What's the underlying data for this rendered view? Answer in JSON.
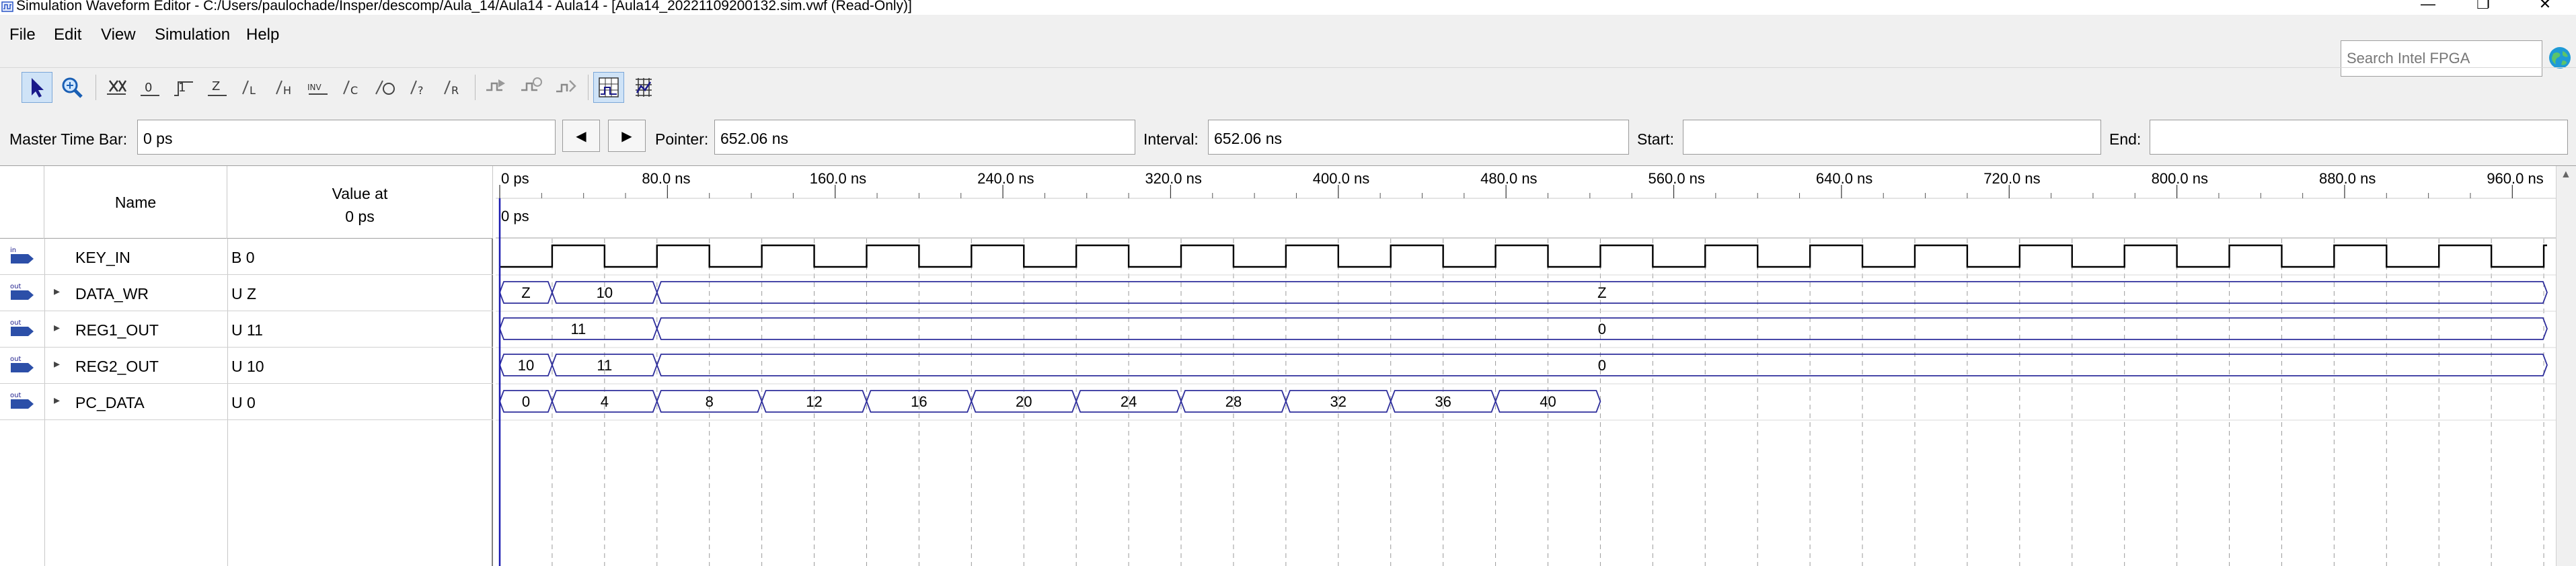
{
  "window": {
    "title": "Simulation Waveform Editor - C:/Users/paulochade/Insper/descomp/Aula_14/Aula14 - Aula14 - [Aula14_20221109200132.sim.vwf (Read-Only)]",
    "minimize": "—",
    "maximize": "❐",
    "close": "✕"
  },
  "menu": {
    "file": "File",
    "edit": "Edit",
    "view": "View",
    "simulation": "Simulation",
    "help": "Help"
  },
  "search": {
    "placeholder": "Search Intel FPGA"
  },
  "timebar": {
    "master_label": "Master Time Bar:",
    "master_value": "0 ps",
    "prev_arrow": "◀",
    "next_arrow": "▶",
    "pointer_label": "Pointer:",
    "pointer_value": "652.06 ns",
    "interval_label": "Interval:",
    "interval_value": "652.06 ns",
    "start_label": "Start:",
    "start_value": "",
    "end_label": "End:",
    "end_value": ""
  },
  "table": {
    "name_header": "Name",
    "value_header_line1": "Value at",
    "value_header_line2": "0 ps",
    "cursor_label": "0 ps"
  },
  "time_axis": {
    "ticks": [
      "0 ps",
      "80.0 ns",
      "160.0 ns",
      "240.0 ns",
      "320.0 ns",
      "400.0 ns",
      "480.0 ns",
      "560.0 ns",
      "640.0 ns",
      "720.0 ns",
      "800.0 ns",
      "880.0 ns",
      "960.0 ns"
    ],
    "ns_per_division": 80,
    "range_ns": [
      0,
      1000
    ],
    "period_ns": 50
  },
  "signals": [
    {
      "name": "KEY_IN",
      "value": "B 0",
      "type": "in",
      "expandable": false,
      "kind": "bit",
      "transitions_ns": [
        0,
        25,
        50,
        75,
        100,
        125,
        150,
        175,
        200,
        225,
        250,
        275,
        300,
        325,
        350,
        375,
        400,
        425,
        450,
        475,
        500,
        525,
        550,
        575,
        600,
        625,
        650,
        675,
        700,
        725,
        750,
        775,
        800,
        825,
        850,
        875,
        900,
        925,
        950,
        975
      ],
      "levels": [
        0,
        1,
        0,
        1,
        0,
        1,
        0,
        1,
        0,
        1,
        0,
        1,
        0,
        1,
        0,
        1,
        0,
        1,
        0,
        1,
        0,
        1,
        0,
        1,
        0,
        1,
        0,
        1,
        0,
        1,
        0,
        1,
        0,
        1,
        0,
        1,
        0,
        1,
        0,
        1
      ]
    },
    {
      "name": "DATA_WR",
      "value": "U Z",
      "type": "out",
      "expandable": true,
      "kind": "bus",
      "segments": [
        {
          "start": 0,
          "end": 25,
          "label": "Z"
        },
        {
          "start": 25,
          "end": 75,
          "label": "10"
        },
        {
          "start": 75,
          "end": 1000,
          "label": "Z"
        }
      ]
    },
    {
      "name": "REG1_OUT",
      "value": "U 11",
      "type": "out",
      "expandable": true,
      "kind": "bus",
      "segments": [
        {
          "start": 0,
          "end": 75,
          "label": "11"
        },
        {
          "start": 75,
          "end": 1000,
          "label": "0"
        }
      ]
    },
    {
      "name": "REG2_OUT",
      "value": "U 10",
      "type": "out",
      "expandable": true,
      "kind": "bus",
      "segments": [
        {
          "start": 0,
          "end": 25,
          "label": "10"
        },
        {
          "start": 25,
          "end": 75,
          "label": "11"
        },
        {
          "start": 75,
          "end": 1000,
          "label": "0"
        }
      ]
    },
    {
      "name": "PC_DATA",
      "value": "U 0",
      "type": "out",
      "expandable": true,
      "kind": "bus",
      "segments": [
        {
          "start": 0,
          "end": 25,
          "label": "0"
        },
        {
          "start": 25,
          "end": 75,
          "label": "4"
        },
        {
          "start": 75,
          "end": 125,
          "label": "8"
        },
        {
          "start": 125,
          "end": 175,
          "label": "12"
        },
        {
          "start": 175,
          "end": 225,
          "label": "16"
        },
        {
          "start": 225,
          "end": 275,
          "label": "20"
        },
        {
          "start": 275,
          "end": 325,
          "label": "24"
        },
        {
          "start": 325,
          "end": 375,
          "label": "28"
        },
        {
          "start": 375,
          "end": 425,
          "label": "32"
        },
        {
          "start": 425,
          "end": 475,
          "label": "36"
        },
        {
          "start": 475,
          "end": 525,
          "label": "40"
        }
      ]
    }
  ],
  "colors": {
    "wave": "#000000",
    "bus": "#2f2f9c",
    "grid": "#9a9a9a",
    "cursor": "#1b1bb0"
  }
}
